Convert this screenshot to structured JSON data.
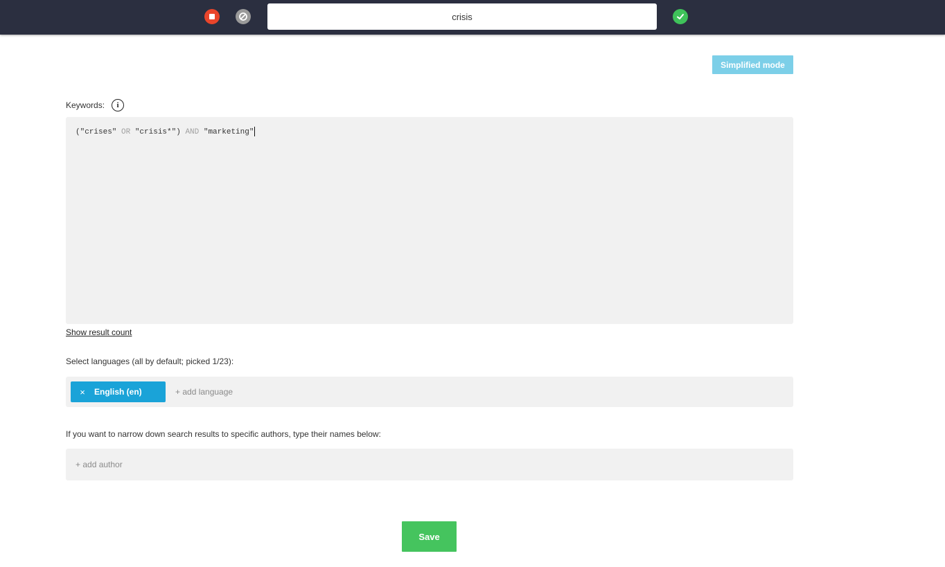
{
  "topbar": {
    "project_name": "crisis"
  },
  "simplified_mode_label": "Simplified mode",
  "keywords": {
    "label": "Keywords:",
    "info_glyph": "i",
    "query": {
      "p1": "(\"crises\" ",
      "op1": "OR",
      "p2": " \"crisis*\") ",
      "op2": "AND",
      "p3": " \"marketing\""
    }
  },
  "show_result_count": "Show result count",
  "languages": {
    "label": "Select languages (all by default; picked 1/23):",
    "selected": [
      {
        "remove_glyph": "×",
        "label": "English (en)"
      }
    ],
    "add_label": "+ add language"
  },
  "authors": {
    "label": "If you want to narrow down search results to specific authors, type their names below:",
    "add_label": "+ add author"
  },
  "save_label": "Save",
  "colors": {
    "topbar_bg": "#2b2f40",
    "stop_red": "#e9452b",
    "confirm_green": "#3fc25a",
    "accent_blue": "#1aa3d8",
    "simplified_blue": "#7ccfe8",
    "save_green": "#45c45e"
  }
}
